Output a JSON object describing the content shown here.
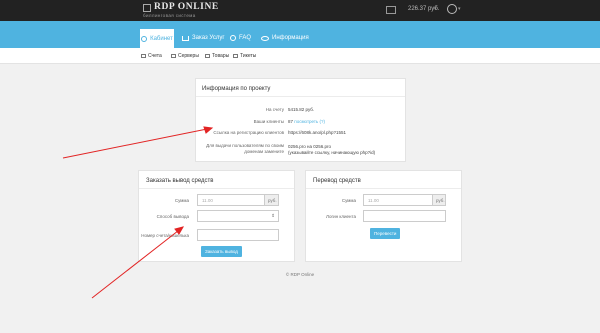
{
  "header": {
    "logo_title": "RDP ONLINE",
    "logo_subtitle": "биллинговая система",
    "balance": "226.37 руб.",
    "balance_icon": "wallet-icon",
    "user_icon": "user-icon"
  },
  "nav": {
    "tabs": [
      {
        "label": "Кабинет",
        "icon": "user-icon",
        "active": true
      },
      {
        "label": "Заказ Услуг",
        "icon": "cart-icon",
        "active": false
      },
      {
        "label": "FAQ",
        "icon": "question-icon",
        "active": false
      },
      {
        "label": "Информация",
        "icon": "eye-icon",
        "active": false
      }
    ],
    "subnav": [
      {
        "label": "Счета",
        "icon": "file-icon"
      },
      {
        "label": "Серверы",
        "icon": "server-icon"
      },
      {
        "label": "Товары",
        "icon": "box-icon"
      },
      {
        "label": "Тикеты",
        "icon": "ticket-icon"
      }
    ]
  },
  "info_panel": {
    "title": "Информация по проекту",
    "rows": [
      {
        "label": "На счету",
        "value": "5415.82 руб."
      },
      {
        "label": "Ваши клиенты",
        "value": "87 ",
        "link": "посмотреть (?)"
      },
      {
        "label": "Ссылка на регистрацию клиентов",
        "value": "https://608k.ano/pl.php?1551"
      },
      {
        "label": "Для выдачи пользователям по своим доменам замените",
        "value": "0256.pro на 0256.pro",
        "value2": "(указывайте ссылку, начинающую php?id)"
      }
    ]
  },
  "withdraw_panel": {
    "title": "Заказать вывод средств",
    "sum_label": "Сумма",
    "sum_placeholder": "11.00",
    "sum_addon": "руб.",
    "method_label": "Способ вывода",
    "account_label": "Номер счета/кошелька",
    "submit_label": "Заказать вывод"
  },
  "transfer_panel": {
    "title": "Перевод средств",
    "sum_label": "Сумма",
    "sum_placeholder": "11.00",
    "sum_addon": "руб.",
    "recipient_label": "Логин клиента",
    "submit_label": "Перевести"
  },
  "footer": {
    "copyright": "© RDP Online"
  },
  "colors": {
    "topbar": "#222222",
    "accent": "#4fb3e0",
    "annotation_arrow": "#e22424"
  }
}
